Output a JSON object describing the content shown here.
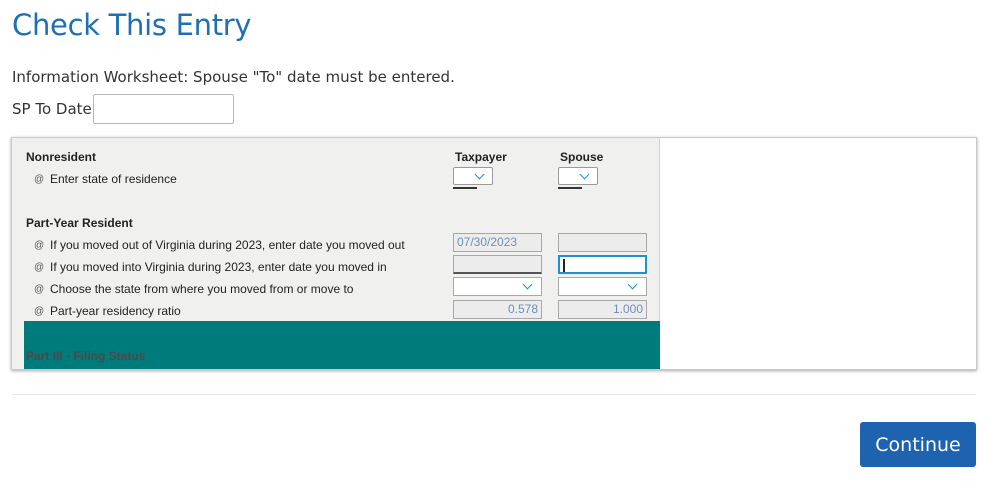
{
  "page": {
    "title": "Check This Entry",
    "message": "Information Worksheet: Spouse \"To\" date must be entered.",
    "sp_to_date_label": "SP To Date",
    "sp_to_date_value": ""
  },
  "form": {
    "nonresident_heading": "Nonresident",
    "taxpayer_heading": "Taxpayer",
    "spouse_heading": "Spouse",
    "marker": "@",
    "rows": [
      {
        "label": "Enter state of residence",
        "taxpayer": "",
        "spouse": ""
      },
      {
        "label": "If you moved out of Virginia during 2023, enter date you moved out",
        "taxpayer": "07/30/2023",
        "spouse": ""
      },
      {
        "label": "If you moved into Virginia during 2023, enter date you moved in",
        "taxpayer": "",
        "spouse": ""
      },
      {
        "label": "Choose the state from where you moved from or move to",
        "taxpayer": "",
        "spouse": ""
      },
      {
        "label": "Part-year residency ratio",
        "taxpayer": "0.578",
        "spouse": "1.000"
      }
    ],
    "part_year_heading": "Part-Year Resident",
    "part3_title": "Part III · Filing Status"
  },
  "actions": {
    "continue_label": "Continue"
  },
  "colors": {
    "title_blue": "#1f6fb5",
    "button_blue": "#1e63b0",
    "teal": "#007b7b",
    "focus_blue": "#1f8fd6"
  }
}
